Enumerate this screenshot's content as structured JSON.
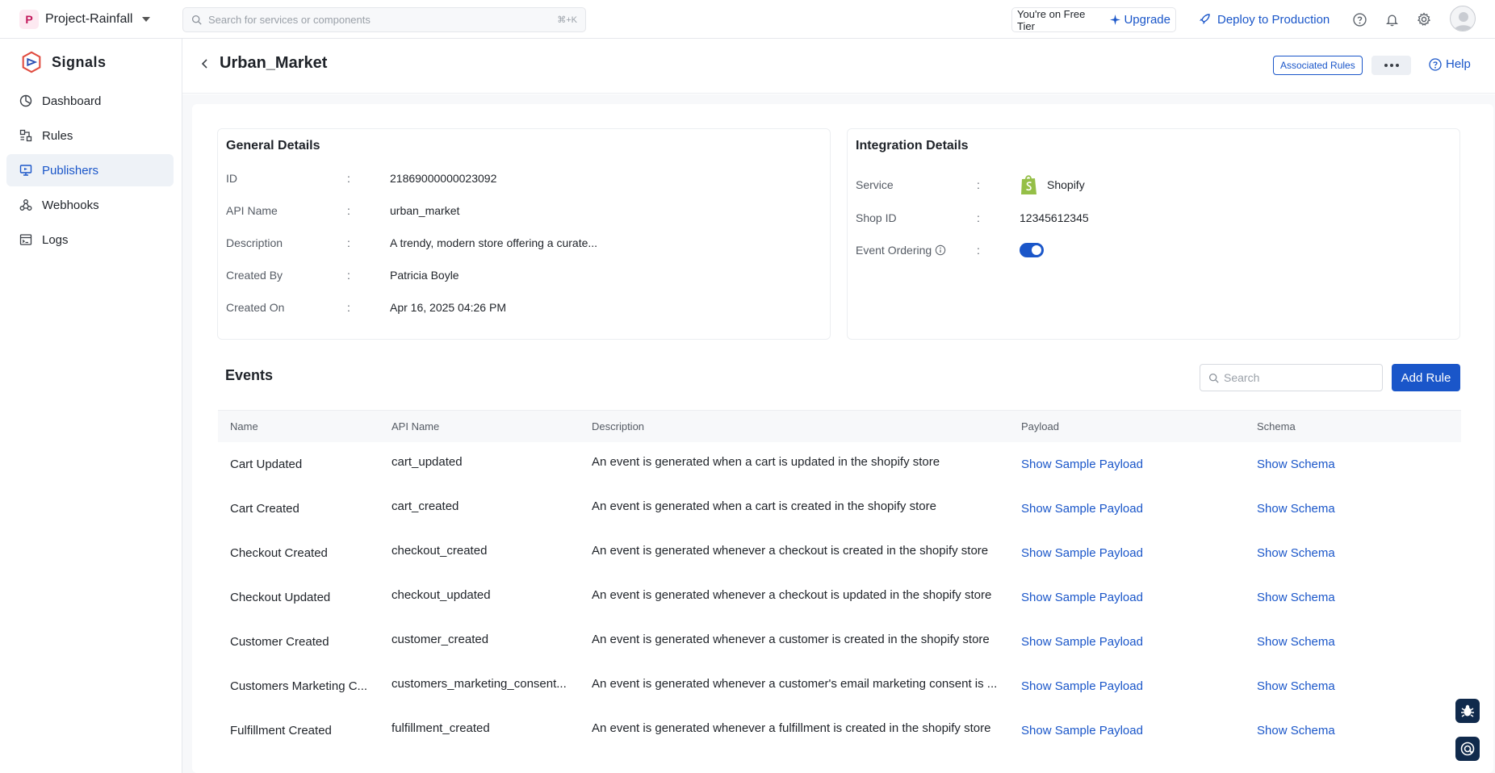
{
  "topbar": {
    "project_initial": "P",
    "project_name": "Project-Rainfall",
    "search_placeholder": "Search for services or components",
    "search_shortcut": "⌘+K",
    "tier_text": "You're on Free Tier",
    "upgrade_label": "Upgrade",
    "deploy_label": "Deploy to Production"
  },
  "sidebar": {
    "brand": "Signals",
    "items": [
      {
        "label": "Dashboard"
      },
      {
        "label": "Rules"
      },
      {
        "label": "Publishers"
      },
      {
        "label": "Webhooks"
      },
      {
        "label": "Logs"
      }
    ]
  },
  "header": {
    "title": "Urban_Market",
    "associated_rules": "Associated Rules",
    "help": "Help"
  },
  "general": {
    "title": "General Details",
    "rows": [
      {
        "label": "ID",
        "value": "21869000000023092"
      },
      {
        "label": "API Name",
        "value": "urban_market"
      },
      {
        "label": "Description",
        "value": "A trendy, modern store offering a curate..."
      },
      {
        "label": "Created By",
        "value": "Patricia Boyle"
      },
      {
        "label": "Created On",
        "value": "Apr 16, 2025 04:26 PM"
      }
    ],
    "colon": ":"
  },
  "integration": {
    "title": "Integration Details",
    "service_label": "Service",
    "service_value": "Shopify",
    "shop_label": "Shop ID",
    "shop_value": "12345612345",
    "ordering_label": "Event Ordering",
    "ordering_enabled": true
  },
  "events": {
    "title": "Events",
    "search_placeholder": "Search",
    "add_rule": "Add Rule",
    "columns": [
      "Name",
      "API Name",
      "Description",
      "Payload",
      "Schema"
    ],
    "payload_link": "Show Sample Payload",
    "schema_link": "Show Schema",
    "rows": [
      {
        "name": "Cart Updated",
        "api": "cart_updated",
        "desc": "An event is generated when a cart is updated in the shopify store"
      },
      {
        "name": "Cart Created",
        "api": "cart_created",
        "desc": "An event is generated when a cart is created in the shopify store"
      },
      {
        "name": "Checkout Created",
        "api": "checkout_created",
        "desc": "An event is generated whenever a checkout is created in the shopify store"
      },
      {
        "name": "Checkout Updated",
        "api": "checkout_updated",
        "desc": "An event is generated whenever a checkout is updated in the shopify store"
      },
      {
        "name": "Customer Created",
        "api": "customer_created",
        "desc": "An event is generated whenever a customer is created in the shopify store"
      },
      {
        "name": "Customers Marketing C...",
        "api": "customers_marketing_consent...",
        "desc": "An event is generated whenever a customer's email marketing consent is ..."
      },
      {
        "name": "Fulfillment Created",
        "api": "fulfillment_created",
        "desc": "An event is generated whenever a fulfillment is created in the shopify store"
      }
    ]
  },
  "colors": {
    "accent": "#1a56c9",
    "active_bg": "#eef2f7",
    "shopify_green": "#95bf47"
  }
}
